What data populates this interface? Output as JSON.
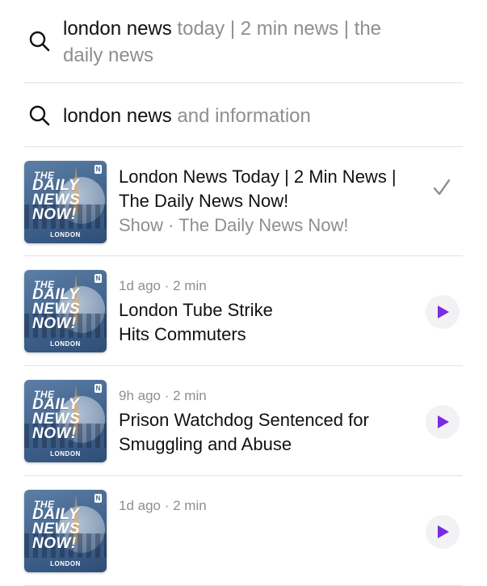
{
  "suggestions": [
    {
      "query": "london news",
      "completion": " today | 2 min news | the daily news",
      "icon": "search-icon"
    },
    {
      "query": "london news",
      "completion": " and information",
      "icon": "search-icon"
    }
  ],
  "show": {
    "title": "London News Today | 2 Min News | The Daily News Now!",
    "subtitle": "Show · The Daily News Now!",
    "status_icon": "checkmark-icon"
  },
  "artwork": {
    "line1": "THE",
    "line2": "DAILY",
    "line3": "NEWS",
    "line4": "NOW!",
    "location": "LONDON",
    "badge": "N"
  },
  "episodes": [
    {
      "meta": "1d ago · 2 min",
      "title_line1": "London Tube Strike",
      "title_line2": "Hits Commuters"
    },
    {
      "meta": "9h ago · 2 min",
      "title_line1": "Prison Watchdog Sentenced for",
      "title_line2": "Smuggling and Abuse"
    },
    {
      "meta": "1d ago · 2 min",
      "title_line1": "",
      "title_line2": ""
    }
  ],
  "colors": {
    "accent": "#7a2ae0",
    "secondary_text": "#8e8e93",
    "divider": "#e2e2e4"
  }
}
